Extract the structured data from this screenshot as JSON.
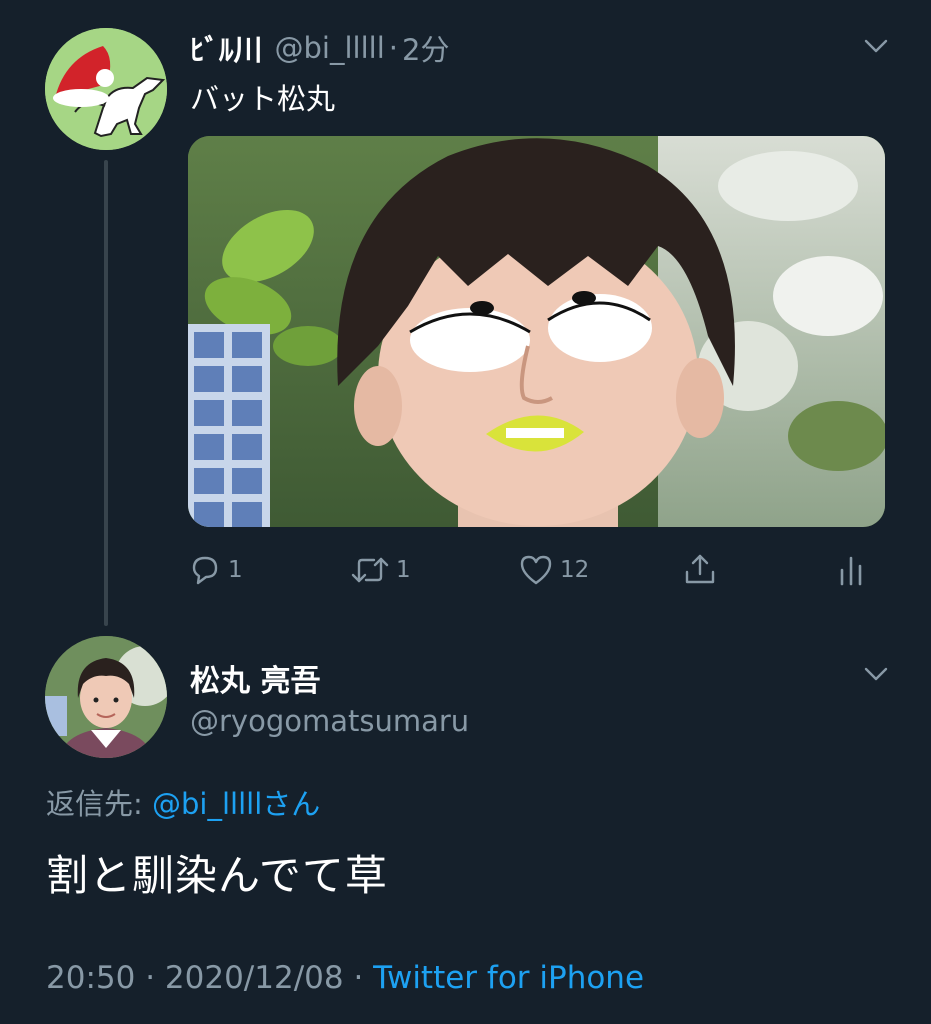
{
  "parent_tweet": {
    "display_name": "ﾋﾞﾙ川",
    "handle": "@bi_lllll",
    "separator": "·",
    "time": "2分",
    "text": "バット松丸",
    "avatar_icon": "dinosaur-with-santa-hat-avatar",
    "media_description_icon": "photo-with-cartoon-face",
    "actions": {
      "reply_count": "1",
      "retweet_count": "1",
      "like_count": "12"
    }
  },
  "reply_tweet": {
    "display_name": "松丸 亮吾",
    "handle": "@ryogomatsumaru",
    "replying_to_prefix": "返信先: ",
    "replying_to_mention": "@bi_lllllさん",
    "text": "割と馴染んでて草",
    "time": "20:50",
    "separator_1": " · ",
    "date": "2020/12/08",
    "separator_2": " · ",
    "source": "Twitter for iPhone"
  },
  "colors": {
    "background": "#15202b",
    "secondary_text": "#8899a6",
    "link": "#1da1f2",
    "thread_line": "#38444d"
  }
}
